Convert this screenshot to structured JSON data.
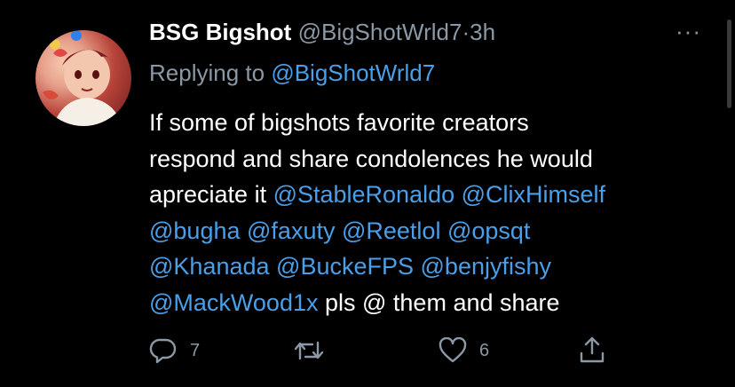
{
  "tweet": {
    "display_name": "BSG Bigshot",
    "handle": "@BigShotWrld7",
    "separator": "·",
    "time": "3h",
    "more_label": "···",
    "replying_prefix": "Replying to",
    "replying_handle": "@BigShotWrld7",
    "body_lines": [
      [
        {
          "text": "If some of bigshots favorite creators",
          "link": false
        }
      ],
      [
        {
          "text": "respond and share condolences he would",
          "link": false
        }
      ],
      [
        {
          "text": "apreciate it ",
          "link": false
        },
        {
          "text": "@StableRonaldo",
          "link": true
        },
        {
          "text": " ",
          "link": false
        },
        {
          "text": "@ClixHimself",
          "link": true
        }
      ],
      [
        {
          "text": "@bugha",
          "link": true
        },
        {
          "text": " ",
          "link": false
        },
        {
          "text": "@faxuty",
          "link": true
        },
        {
          "text": " ",
          "link": false
        },
        {
          "text": "@Reetlol",
          "link": true
        },
        {
          "text": " ",
          "link": false
        },
        {
          "text": "@opsqt",
          "link": true
        }
      ],
      [
        {
          "text": "@Khanada",
          "link": true
        },
        {
          "text": " ",
          "link": false
        },
        {
          "text": "@BuckeFPS",
          "link": true
        },
        {
          "text": " ",
          "link": false
        },
        {
          "text": "@benjyfishy",
          "link": true
        }
      ],
      [
        {
          "text": "@MackWood1x",
          "link": true
        },
        {
          "text": " pls @ them and share",
          "link": false
        }
      ]
    ],
    "actions": {
      "reply_count": "7",
      "retweet_count": "",
      "like_count": "6",
      "share_count": ""
    }
  },
  "icons": {
    "reply": "reply-icon",
    "retweet": "retweet-icon",
    "like": "heart-icon",
    "share": "share-icon"
  },
  "colors": {
    "background": "#000000",
    "text": "#ffffff",
    "muted": "#8b98a5",
    "link": "#4a9fe8"
  }
}
